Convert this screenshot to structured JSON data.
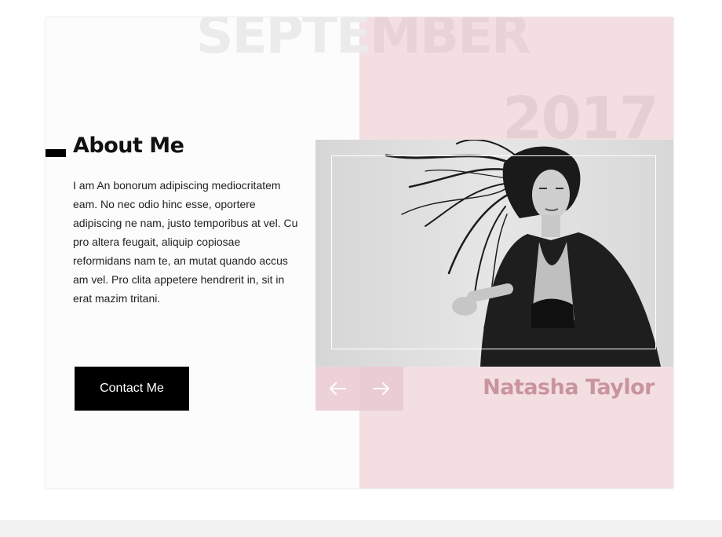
{
  "background": {
    "month_part1": "SEPTE",
    "month_part2": "MBER",
    "year": "2017"
  },
  "about": {
    "title": "About Me",
    "bio": "I am An bonorum adipiscing mediocritatem eam. No nec odio hinc esse, oportere adipiscing ne nam, justo temporibus at vel. Cu pro altera feugait, aliquip copiosae reformidans nam te, an mutat quando accus am vel. Pro clita appetere hendrerit in, sit in erat mazim tritani.",
    "contact_label": "Contact Me"
  },
  "profile": {
    "name": "Natasha Taylor",
    "photo_icon": "portrait-photo",
    "prev_icon": "arrow-left-icon",
    "next_icon": "arrow-right-icon"
  },
  "colors": {
    "accent_pink": "#f3dfe2",
    "name_color": "#c9949e",
    "button_bg": "#000000"
  }
}
